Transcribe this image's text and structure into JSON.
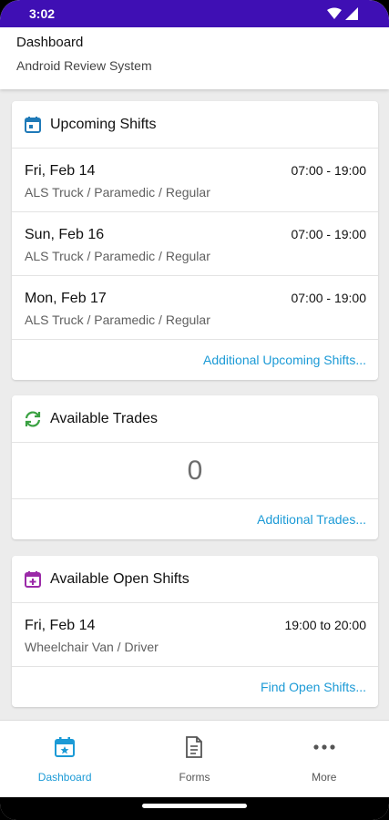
{
  "status_bar": {
    "time": "3:02",
    "color": "#3f0fb4"
  },
  "header": {
    "title": "Dashboard",
    "subtitle": "Android Review System"
  },
  "upcoming": {
    "title": "Upcoming Shifts",
    "icon": "calendar-icon",
    "shifts": [
      {
        "date": "Fri, Feb 14",
        "detail": "ALS Truck / Paramedic / Regular",
        "time": "07:00 - 19:00"
      },
      {
        "date": "Sun, Feb 16",
        "detail": "ALS Truck / Paramedic / Regular",
        "time": "07:00 - 19:00"
      },
      {
        "date": "Mon, Feb 17",
        "detail": "ALS Truck / Paramedic / Regular",
        "time": "07:00 - 19:00"
      }
    ],
    "link": "Additional Upcoming Shifts..."
  },
  "trades": {
    "title": "Available Trades",
    "icon": "refresh-icon",
    "count": "0",
    "link": "Additional Trades..."
  },
  "open_shifts": {
    "title": "Available Open Shifts",
    "icon": "calendar-plus-icon",
    "shifts": [
      {
        "date": "Fri, Feb 14",
        "detail": "Wheelchair Van / Driver",
        "time": "19:00 to 20:00"
      }
    ],
    "link": "Find Open Shifts..."
  },
  "nav": {
    "items": [
      {
        "label": "Dashboard",
        "icon": "calendar-star-icon",
        "active": true
      },
      {
        "label": "Forms",
        "icon": "document-icon",
        "active": false
      },
      {
        "label": "More",
        "icon": "more-icon",
        "active": false
      }
    ]
  },
  "colors": {
    "accent": "#1b9ad6",
    "trades_icon": "#3aa142",
    "open_shifts_icon": "#9b2aa8",
    "upcoming_icon": "#1f7ab8"
  }
}
